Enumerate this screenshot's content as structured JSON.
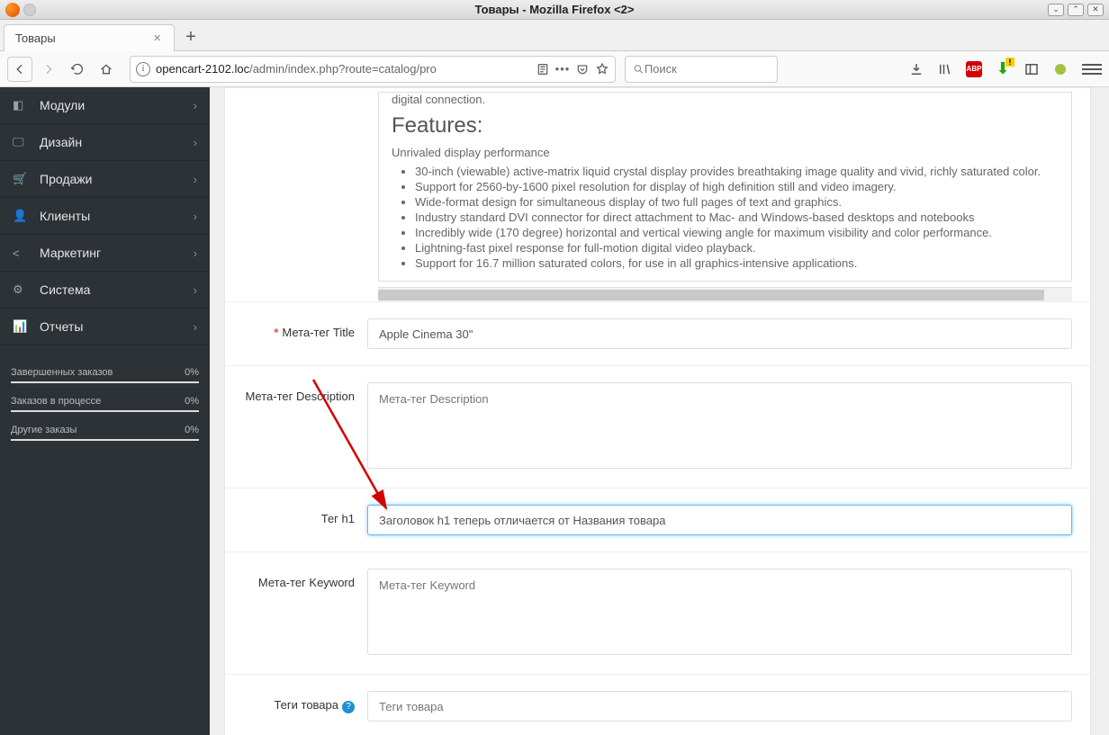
{
  "window": {
    "title": "Товары - Mozilla Firefox <2>"
  },
  "tab": {
    "label": "Товары"
  },
  "url": {
    "host": "opencart-2102.loc",
    "path": "/admin/index.php?route=catalog/pro"
  },
  "search": {
    "placeholder": "Поиск"
  },
  "sidebar": {
    "items": [
      {
        "label": "Модули",
        "icon": "puzzle"
      },
      {
        "label": "Дизайн",
        "icon": "desktop"
      },
      {
        "label": "Продажи",
        "icon": "cart"
      },
      {
        "label": "Клиенты",
        "icon": "user"
      },
      {
        "label": "Маркетинг",
        "icon": "share"
      },
      {
        "label": "Система",
        "icon": "gear"
      },
      {
        "label": "Отчеты",
        "icon": "chart"
      }
    ],
    "stats": [
      {
        "label": "Завершенных заказов",
        "value": "0%"
      },
      {
        "label": "Заказов в процессе",
        "value": "0%"
      },
      {
        "label": "Другие заказы",
        "value": "0%"
      }
    ]
  },
  "description": {
    "cut_line": "digital connection.",
    "features_heading": "Features:",
    "subheading": "Unrivaled display performance",
    "bullets": [
      "30-inch (viewable) active-matrix liquid crystal display provides breathtaking image quality and vivid, richly saturated color.",
      "Support for 2560-by-1600 pixel resolution for display of high definition still and video imagery.",
      "Wide-format design for simultaneous display of two full pages of text and graphics.",
      "Industry standard DVI connector for direct attachment to Mac- and Windows-based desktops and notebooks",
      "Incredibly wide (170 degree) horizontal and vertical viewing angle for maximum visibility and color performance.",
      "Lightning-fast pixel response for full-motion digital video playback.",
      "Support for 16.7 million saturated colors, for use in all graphics-intensive applications."
    ]
  },
  "fields": {
    "meta_title": {
      "label": "Мета-тег Title",
      "value": "Apple Cinema 30\"",
      "required": true
    },
    "meta_desc": {
      "label": "Мета-тег Description",
      "placeholder": "Мета-тег Description"
    },
    "tag_h1": {
      "label": "Тег h1",
      "value": "Заголовок h1 теперь отличается от Названия товара"
    },
    "meta_keyword": {
      "label": "Мета-тег Keyword",
      "placeholder": "Мета-тег Keyword"
    },
    "tags": {
      "label": "Теги товара",
      "placeholder": "Теги товара"
    }
  }
}
